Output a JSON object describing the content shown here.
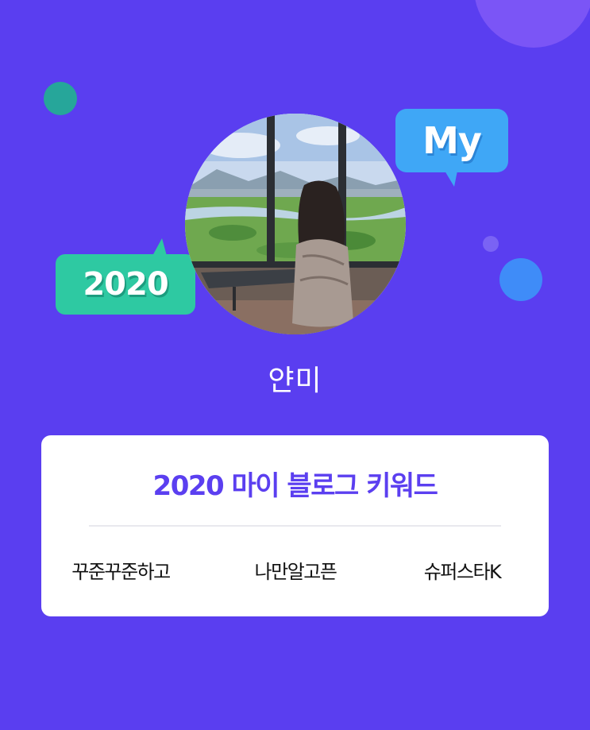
{
  "badges": {
    "my": "My",
    "year": "2020"
  },
  "profile": {
    "name": "얀미"
  },
  "card": {
    "title": "2020 마이 블로그 키워드",
    "keywords": [
      "꾸준꾸준하고",
      "나만알고픈",
      "슈퍼스타K"
    ]
  },
  "colors": {
    "background": "#5a3ef0",
    "title_accent": "#5b3ff0",
    "my_bubble": "#3fa7f6",
    "year_bubble": "#2ec9a2"
  }
}
